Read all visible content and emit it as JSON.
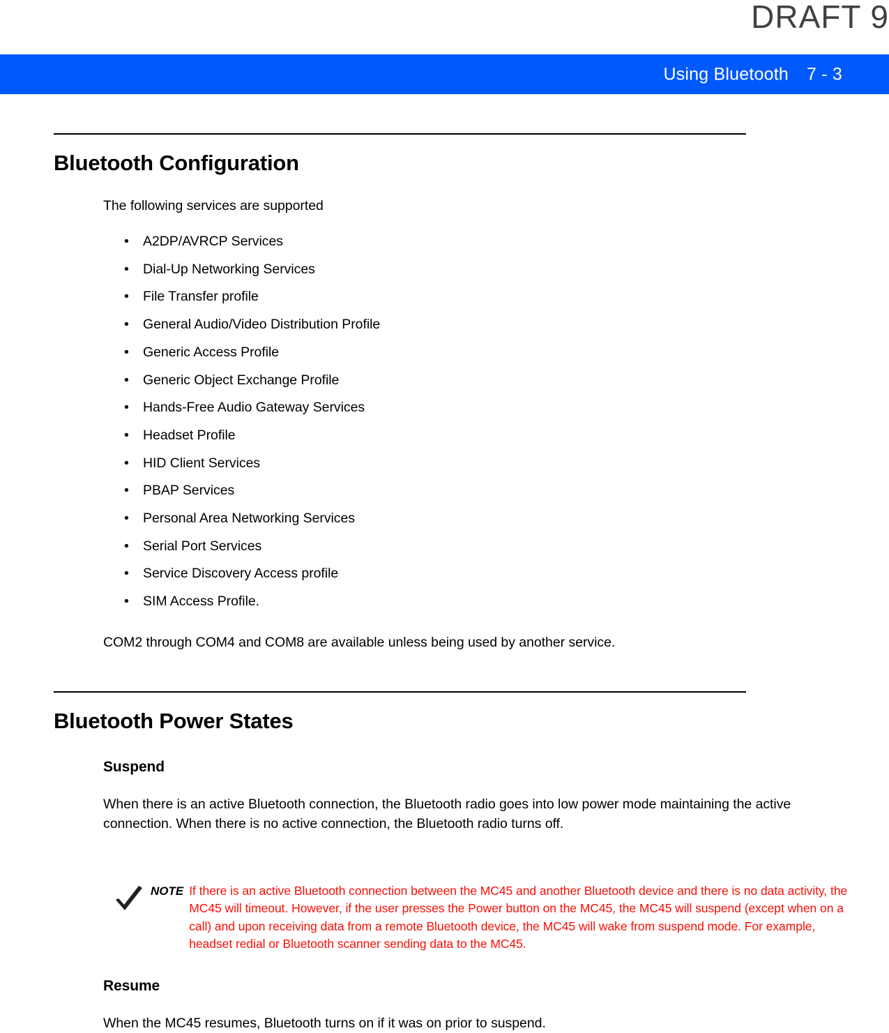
{
  "watermark": {
    "text": "DRAFT 9"
  },
  "header": {
    "chapter_title": "Using Bluetooth",
    "page_number": "7 - 3",
    "background_color": "#0059fa",
    "text_color": "#ffffff"
  },
  "sections": [
    {
      "heading": "Bluetooth Configuration",
      "intro": "The following services are supported",
      "bullet_glyph": "•",
      "items": [
        "A2DP/AVRCP Services",
        "Dial-Up Networking Services",
        "File Transfer profile",
        "General Audio/Video Distribution Profile",
        "Generic Access Profile",
        "Generic Object Exchange Profile",
        "Hands-Free Audio Gateway Services",
        "Headset Profile",
        "HID Client Services",
        "PBAP Services",
        "Personal Area Networking Services",
        "Serial Port Services",
        "Service Discovery Access profile",
        "SIM Access Profile."
      ],
      "closing": "COM2 through COM4 and COM8 are available unless being used by another service."
    },
    {
      "heading": "Bluetooth Power States",
      "subsections": [
        {
          "title": "Suspend",
          "body": "When there is an active Bluetooth connection, the Bluetooth radio goes into low power mode maintaining the active connection. When there is no active connection, the Bluetooth radio turns off."
        },
        {
          "title": "Resume",
          "body": "When the MC45 resumes, Bluetooth turns on if it was on prior to suspend."
        }
      ]
    }
  ],
  "note": {
    "icon": "checkmark-icon",
    "label": "NOTE",
    "text": "If there is an active Bluetooth connection between the MC45 and another Bluetooth device and there is no data activity, the MC45 will timeout. However, if the user presses the Power button on the MC45, the MC45 will suspend (except when on a call) and upon receiving data from a remote Bluetooth device, the MC45 will wake from suspend mode. For example, headset redial or Bluetooth scanner sending data to the MC45.",
    "text_color": "#fa0f05"
  }
}
